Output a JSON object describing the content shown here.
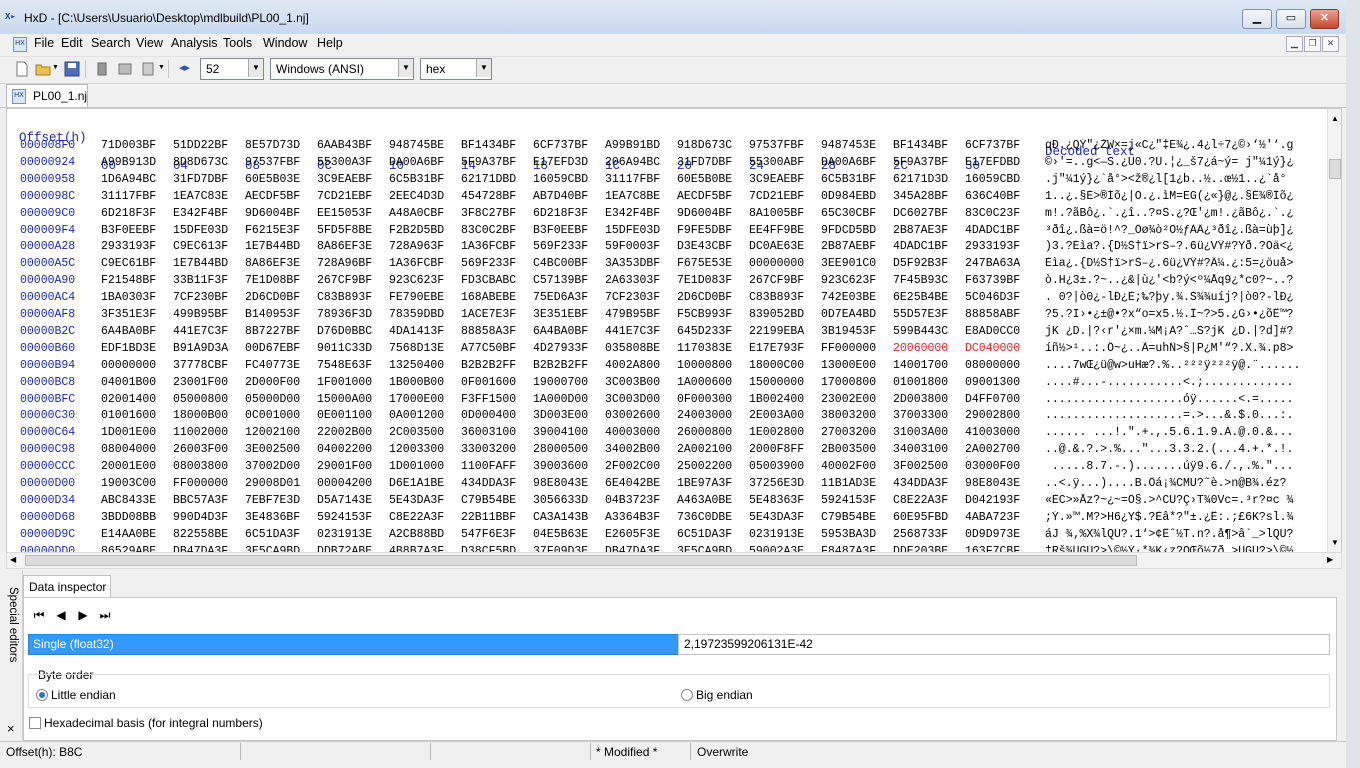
{
  "window": {
    "title": "HxD - [C:\\Users\\Usuario\\Desktop\\mdlbuild\\PL00_1.nj]",
    "app_icon": "HxD-icon"
  },
  "menu": [
    "File",
    "Edit",
    "Search",
    "View",
    "Analysis",
    "Tools",
    "Window",
    "Help"
  ],
  "toolbar": {
    "bytes_per_row": "52",
    "charset": "Windows (ANSI)",
    "offset_base": "hex"
  },
  "document_tab": "PL00_1.nj",
  "hex": {
    "header_offset": "Offset(h)",
    "header_cols": [
      "00",
      "04",
      "08",
      "0C",
      "10",
      "14",
      "18",
      "1C",
      "20",
      "24",
      "28",
      "2C",
      "30"
    ],
    "header_decoded": "Decoded text",
    "rows": [
      {
        "o": "000008F0",
        "w": [
          "71D003BF",
          "51DD22BF",
          "8E57D73D",
          "6AAB43BF",
          "948745BE",
          "BF1434BF",
          "6CF737BF",
          "A99B91BD",
          "918D673C",
          "97537FBF",
          "9487453E",
          "BF1434BF",
          "6CF737BF"
        ],
        "d": "qÐ.¿QÝ\"¿ŽW×=j«C¿\"‡E¾¿.4¿l÷7¿©›‘½'‘.g"
      },
      {
        "o": "00000924",
        "w": [
          "A99B913D",
          "8D8D673C",
          "97537FBF",
          "55300A3F",
          "DA00A6BF",
          "5F9A37BF",
          "E17EFD3D",
          "206A94BC",
          "31FD7DBF",
          "55300ABF",
          "DA00A6BF",
          "5F9A37BF",
          "E17EFDBD"
        ],
        "d": "©›'=..g<—S.¿U0.?Ú.¦¿_š7¿á~ý= j\"¼1ý}¿"
      },
      {
        "o": "00000958",
        "w": [
          "1D6A94BC",
          "31FD7DBF",
          "60E5B03E",
          "3C9EAEBF",
          "6C5B31BF",
          "62171DBD",
          "16059CBD",
          "31117FBF",
          "60E5B0BE",
          "3C9EAEBF",
          "6C5B31BF",
          "62171D3D",
          "16059CBD"
        ],
        "d": ".j\"¼1ý}¿`å°><ž®¿l[1¿b..½..œ½1..¿`å°"
      },
      {
        "o": "0000098C",
        "w": [
          "31117FBF",
          "1EA7C83E",
          "AECDF5BF",
          "7CD21EBF",
          "2EEC4D3D",
          "454728BF",
          "AB7D40BF",
          "1EA7C8BE",
          "AECDF5BF",
          "7CD21EBF",
          "0D984EBD",
          "345A28BF",
          "636C40BF"
        ],
        "d": "1..¿.§È>®Íõ¿|Ò.¿.ìM=EG(¿«}@¿.§È¾®Íõ¿"
      },
      {
        "o": "000009C0",
        "w": [
          "6D218F3F",
          "E342F4BF",
          "9D6004BF",
          "EE15053F",
          "A48A0CBF",
          "3F8C27BF",
          "6D218F3F",
          "E342F4BF",
          "9D6004BF",
          "8A1005BF",
          "65C30CBF",
          "DC6027BF",
          "83C0C23F"
        ],
        "d": "m!.?ãBô¿.`.¿î..?¤Š.¿?Œ'¿m!.¿ãBô¿.`.¿"
      },
      {
        "o": "000009F4",
        "w": [
          "B3F0EEBF",
          "15DFE03D",
          "F6215E3F",
          "5FD5F8BE",
          "F2B2D5BD",
          "83C0C2BF",
          "B3F0EEBF",
          "15DFE03D",
          "F9FE5DBF",
          "EE4FF9BE",
          "9FDCD5BD",
          "2B87AE3F",
          "4DADC1BF"
        ],
        "d": "³ðî¿.ßà=ö!^?_Õø¾ò²Õ½ƒÀÂ¿³ðî¿.ßà=ùþ]¿"
      },
      {
        "o": "00000A28",
        "w": [
          "2933193F",
          "C9EC613F",
          "1E7B44BD",
          "8A86EF3E",
          "728A963F",
          "1A36FCBF",
          "569F233F",
          "59F0003F",
          "D3E43CBF",
          "DC0AE63E",
          "2B87AEBF",
          "4DADC1BF",
          "2933193F"
        ],
        "d": ")3.?Éìa?.{D½Š†ï>rŠ–?.6ü¿VŸ#?Yð.?Óä<¿"
      },
      {
        "o": "00000A5C",
        "w": [
          "C9EC61BF",
          "1E7B44BD",
          "8A86EF3E",
          "728A96BF",
          "1A36FCBF",
          "569F233F",
          "C4BC00BF",
          "3A353DBF",
          "F675E53E",
          "00000000",
          "3EE901C0",
          "D5F92B3F",
          "247BA63A"
        ],
        "d": "Éìa¿.{D½Š†ï>rŠ–¿.6ü¿VŸ#?Ä¼.¿:5=¿öuå>"
      },
      {
        "o": "00000A90",
        "w": [
          "F21548BF",
          "33B11F3F",
          "7E1D08BF",
          "267CF9BF",
          "923C623F",
          "FD3CBABC",
          "C57139BF",
          "2A63303F",
          "7E1D083F",
          "267CF9BF",
          "923C623F",
          "7F45B93C",
          "F63739BF"
        ],
        "d": "ò.H¿3±.?~..¿&|ù¿'<b?ý<º¼Åq9¿*c0?~..?"
      },
      {
        "o": "00000AC4",
        "w": [
          "1BA0303F",
          "7CF230BF",
          "2D6CD0BF",
          "C83B893F",
          "FE790EBE",
          "168ABEBE",
          "75ED6A3F",
          "7CF2303F",
          "2D6CD0BF",
          "C83B893F",
          "742E03BE",
          "6E25B4BE",
          "5C046D3F"
        ],
        "d": ". 0?|ò0¿-lÐ¿È;‰?þy.¾.Š¾¾uíj?|ò0?-lÐ¿"
      },
      {
        "o": "00000AF8",
        "w": [
          "3F351E3F",
          "499B95BF",
          "B140953F",
          "78936F3D",
          "78359DBD",
          "1ACE7E3F",
          "3E351EBF",
          "479B95BF",
          "F5CB993F",
          "839052BD",
          "0D7EA4BD",
          "55D57E3F",
          "88858ABF"
        ],
        "d": "?5.?I›•¿±@•?x“o=x5.½.Î~?>5.¿G›•¿õË™?"
      },
      {
        "o": "00000B2C",
        "w": [
          "6A4BA0BF",
          "441E7C3F",
          "8B7227BF",
          "D76D0BBC",
          "4DA1413F",
          "88858A3F",
          "6A4BA0BF",
          "441E7C3F",
          "645D233F",
          "22199EBA",
          "3B19453F",
          "599B443C",
          "E8AD0CC0"
        ],
        "d": "jK ¿D.|?‹r'¿×m.¼M¡A?ˆ…Š?jK ¿D.|?d]#?"
      },
      {
        "o": "00000B60",
        "w": [
          "EDF1BD3E",
          "B91A9D3A",
          "00D67EBF",
          "9011C33D",
          "7568D13E",
          "A77C50BF",
          "4D27933F",
          "035808BE",
          "1170383E",
          "E17E793F",
          "FF000000",
          "20060000",
          "DC040000"
        ],
        "d": "íñ½>¹..:.Ö~¿..Ã=uhÑ>§|P¿M'“?.X.¾.p8>"
      },
      {
        "o": "00000B94",
        "w": [
          "00000000",
          "37778CBF",
          "FC40773E",
          "7548E63F",
          "13250400",
          "B2B2B2FF",
          "B2B2B2FF",
          "4002A800",
          "10000800",
          "18000C00",
          "13000E00",
          "14001700",
          "08000000"
        ],
        "d": "....7wŒ¿ü@w>uHæ?.%..²²²ÿ²²²ÿ@.¨......"
      },
      {
        "o": "00000BC8",
        "w": [
          "04001B00",
          "23001F00",
          "2D000F00",
          "1F001000",
          "1B000B00",
          "0F001600",
          "19000700",
          "3C003B00",
          "1A000600",
          "15000000",
          "17000800",
          "01001800",
          "09001300"
        ],
        "d": "....#...-...........<.;............."
      },
      {
        "o": "00000BFC",
        "w": [
          "02001400",
          "05000800",
          "05000D00",
          "15000A00",
          "17000E00",
          "F3FF1500",
          "1A000D00",
          "3C003D00",
          "0F000300",
          "1B002400",
          "23002E00",
          "2D003800",
          "D4FF0700"
        ],
        "d": "....................óÿ......<.=....."
      },
      {
        "o": "00000C30",
        "w": [
          "01001600",
          "18000B00",
          "0C001000",
          "0E001100",
          "0A001200",
          "0D000400",
          "3D003E00",
          "03002600",
          "24003000",
          "2E003A00",
          "38003200",
          "37003300",
          "29002800"
        ],
        "d": "....................=.>...&.$.0...:."
      },
      {
        "o": "00000C64",
        "w": [
          "1D001E00",
          "11002000",
          "12002100",
          "22002B00",
          "2C003500",
          "36003100",
          "39004100",
          "40003000",
          "26000800",
          "1E002800",
          "27003200",
          "31003A00",
          "41003000"
        ],
        "d": "...... ...!.\".+.,.5.6.1.9.A.@.0.&..."
      },
      {
        "o": "00000C98",
        "w": [
          "08004000",
          "26003F00",
          "3E002500",
          "04002200",
          "12003300",
          "33003200",
          "28000500",
          "34002B00",
          "2A002100",
          "2000F8FF",
          "2B003500",
          "34003100",
          "2A002700"
        ],
        "d": "..@.&.?.>.%...\"...3.3.2.(...4.+.*.!."
      },
      {
        "o": "00000CCC",
        "w": [
          "20001E00",
          "08003800",
          "37002D00",
          "29001F00",
          "1D001000",
          "1100FAFF",
          "39003600",
          "2F002C00",
          "25002200",
          "05003900",
          "40002F00",
          "3F002500",
          "03000F00"
        ],
        "d": " .....8.7.-.).......úÿ9.6./.,.%.\"..."
      },
      {
        "o": "00000D00",
        "w": [
          "19003C00",
          "FF000000",
          "29008D01",
          "00004200",
          "D6E1A1BE",
          "434DDA3F",
          "98E8043E",
          "6E4042BE",
          "1BE97A3F",
          "37256E3D",
          "11B1AD3E",
          "434DDA3F",
          "98E8043E"
        ],
        "d": "..<.ÿ...)....B.Öá¡¾CMÚ?˜è.>n@B¾.éz?"
      },
      {
        "o": "00000D34",
        "w": [
          "ABC8433E",
          "BBC57A3F",
          "7EBF7E3D",
          "D5A7143E",
          "5E43DA3F",
          "C79B54BE",
          "3056633D",
          "04B3723F",
          "A463A0BE",
          "5E48363F",
          "5924153F",
          "C8E22A3F",
          "D042193F"
        ],
        "d": "«ÈC>»Åz?~¿~=Õ§.>^CÚ?Ç›T¾0Vc=.³r?¤c ¾"
      },
      {
        "o": "00000D68",
        "w": [
          "3BDD08BB",
          "990D4D3F",
          "3E4836BF",
          "5924153F",
          "C8E22A3F",
          "22B11BBF",
          "CA3A143B",
          "A3364B3F",
          "736C0DBE",
          "5E43DA3F",
          "C79B54BE",
          "60E95FBD",
          "4ABA723F"
        ],
        "d": ";Ý.»™.M?>H6¿Y$.?Èâ*?\"±.¿Ê:.;£6K?sl.¾"
      },
      {
        "o": "00000D9C",
        "w": [
          "E14AA0BE",
          "822558BE",
          "6C51DA3F",
          "0231913E",
          "A2CB88BD",
          "547F6E3F",
          "04E5B63E",
          "E2605F3E",
          "6C51DA3F",
          "0231913E",
          "5953BA3D",
          "2568733F",
          "0D9D973E"
        ],
        "d": "áJ ¾‚%X¾lQÚ?.1‘>¢Ëˆ½T.n?.å¶>â`_>lQÚ?"
      },
      {
        "o": "00000DD0",
        "w": [
          "86529ABE",
          "DB47DA3F",
          "3E5CA9BD",
          "DDB72ABE",
          "4B8B7A3F",
          "D38CF5BD",
          "37F09D3E",
          "DB47DA3F",
          "3E5CA9BD",
          "59002A3E",
          "F8487A3F",
          "DDE203BE",
          "163F7CBF"
        ],
        "d": "†Rš¾ÛGÚ?>\\©½Ý·*¾K‹z?ÓŒõ½7ð.>ÛGÚ?>\\©½"
      },
      {
        "o": "00000E04",
        "w": [
          "018EB03F",
          "9649513D",
          "CF8A7FBF",
          "7221643D",
          "60D1B1BC",
          "B137813F",
          "018EB03F",
          "9E49513D",
          "26A77E3F",
          "6888CD3D",
          "16D4A8BC",
          "0F9C133F",
          "0409B13F"
        ],
        "d": ".Ž°?–IQ=ÏŠ.¿r!d=`Ñ±¼±7.?.Ž°?žIQ=&§~?"
      }
    ],
    "highlight": {
      "row": 12,
      "cols": [
        11,
        12
      ],
      "color": "#e0262c"
    }
  },
  "inspector": {
    "sidebar_label": "Special editors",
    "tab": "Data inspector",
    "data_type": "Single (float32)",
    "value": "2,19723599206131E-42",
    "byte_order_label": "Byte order",
    "little_endian": "Little endian",
    "big_endian": "Big endian",
    "hex_basis": "Hexadecimal basis (for integral numbers)",
    "close": "×"
  },
  "status": {
    "offset": "Offset(h): B8C",
    "modified": "* Modified *",
    "mode": "Overwrite"
  }
}
